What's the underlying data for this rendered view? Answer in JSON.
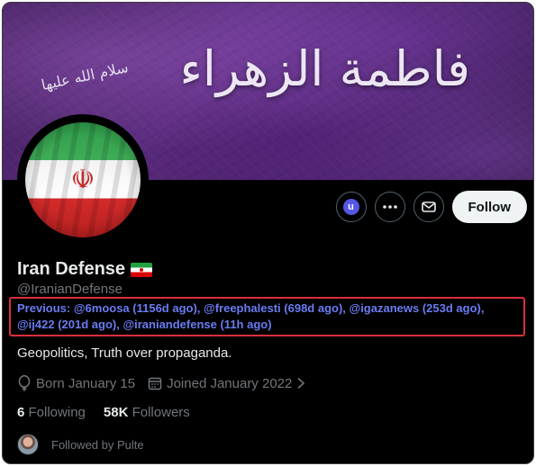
{
  "banner": {
    "calligraphy_main": "فاطمة الزهراء",
    "calligraphy_small": "سلام الله عليها",
    "colors": {
      "primary": "#4b2469",
      "accent": "#8a56b8"
    }
  },
  "profile": {
    "name": "Iran Defense",
    "handle": "@IranianDefense",
    "previous": "Previous: @6moosa (1156d ago), @freephalesti (698d ago), @igazanews (253d ago), @ij422 (201d ago), @iraniandefense (11h ago)",
    "bio": "Geopolitics, Truth over propaganda.",
    "born": "Born January 15",
    "joined": "Joined January 2022",
    "following_count": "6",
    "following_label": "Following",
    "followers_count": "58K",
    "followers_label": "Followers",
    "followed_by": "Followed by Pulte"
  },
  "actions": {
    "u_badge": "u",
    "follow_label": "Follow",
    "icons": [
      "u-extension-icon",
      "more-icon",
      "message-icon"
    ]
  },
  "colors": {
    "background": "#000000",
    "text_primary": "#e7e9ea",
    "text_secondary": "#71767b",
    "highlight_border": "#d8313c",
    "previous_text": "#6a7cf2"
  }
}
